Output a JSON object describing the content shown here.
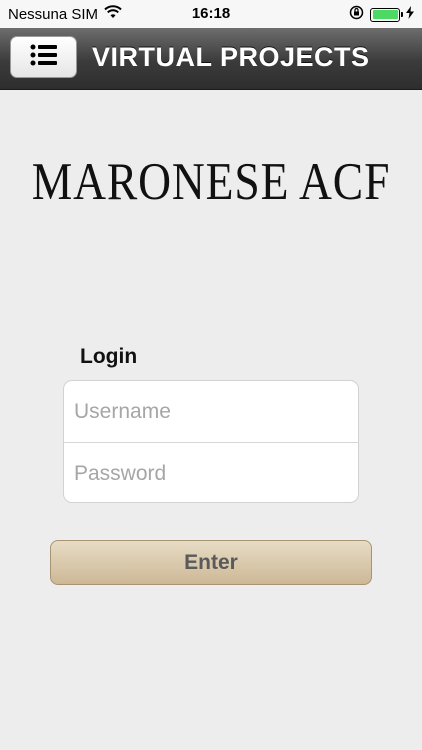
{
  "status_bar": {
    "carrier": "Nessuna SIM",
    "time": "16:18",
    "wifi_icon": "wifi-icon",
    "rotation_lock_icon": "rotation-lock-icon",
    "charging_icon": "charging-bolt-icon",
    "battery_color": "#4cd964"
  },
  "nav_bar": {
    "title": "VIRTUAL PROJECTS",
    "menu_icon": "list-menu-icon"
  },
  "logo": {
    "text": "MARONESE ACF"
  },
  "login": {
    "label": "Login",
    "username_placeholder": "Username",
    "password_placeholder": "Password",
    "enter_label": "Enter",
    "enter_color": "#cdb896"
  }
}
